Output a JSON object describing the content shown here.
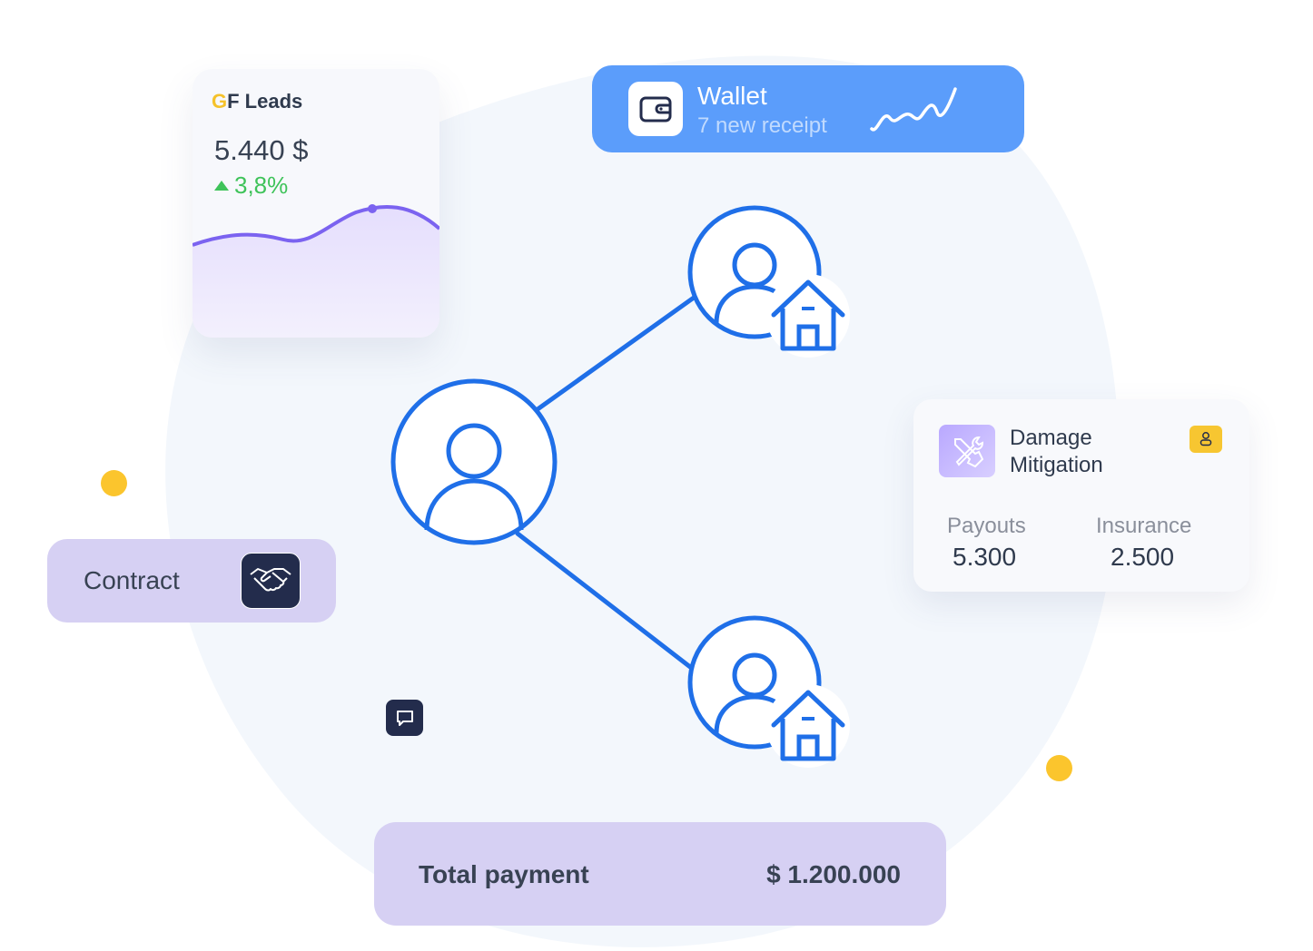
{
  "leads": {
    "brand_g": "G",
    "brand_rest": "F Leads",
    "amount": "5.440 $",
    "change": "3,8%",
    "icons": {
      "trend": "triangle-up-icon"
    }
  },
  "wallet": {
    "title": "Wallet",
    "subtitle": "7 new receipt",
    "icons": {
      "wallet": "wallet-icon",
      "spark": "sparkline-icon"
    }
  },
  "damage": {
    "title_line1": "Damage",
    "title_line2": "Mitigation",
    "payouts_label": "Payouts",
    "payouts_value": "5.300",
    "insurance_label": "Insurance",
    "insurance_value": "2.500",
    "icons": {
      "main": "tools-icon",
      "badge": "user-icon"
    }
  },
  "contract": {
    "label": "Contract",
    "icon": "handshake-icon"
  },
  "total": {
    "label": "Total payment",
    "value": "$ 1.200.000"
  },
  "colors": {
    "accent_blue": "#1f6fe8",
    "wallet_bg": "#5b9dfb",
    "lavender": "#d6d0f3",
    "yellow": "#fbc52d",
    "green": "#3fc35a",
    "purple_line": "#7b63f0",
    "dark_navy": "#232c4c"
  }
}
